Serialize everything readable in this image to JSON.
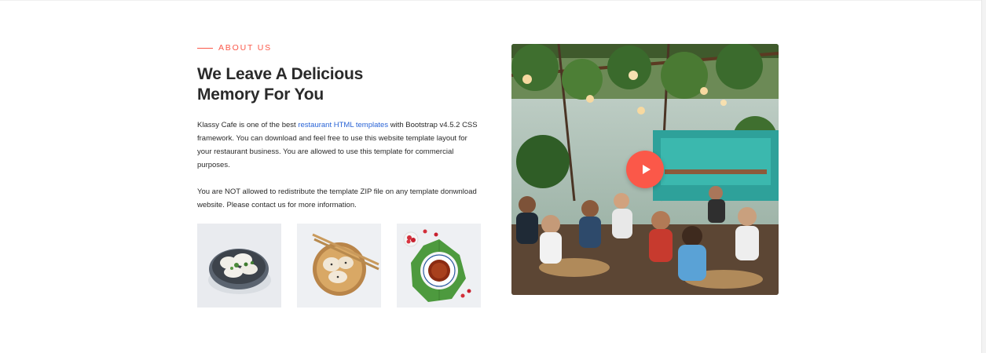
{
  "about": {
    "eyebrow": "About Us",
    "heading": "We Leave A Delicious Memory For You",
    "paragraph1": {
      "before": "Klassy Cafe is one of the best ",
      "link": "restaurant HTML templates",
      "after": " with Bootstrap v4.5.2 CSS framework. You can download and feel free to use this website template layout for your restaurant business. You are allowed to use this template for commercial purposes."
    },
    "paragraph2": "You are NOT allowed to redistribute the template ZIP file on any template donwnload website. Please contact us for more information."
  },
  "thumbnails": [
    {
      "name": "dumplings-bowl-image"
    },
    {
      "name": "dumplings-bamboo-chopsticks-image"
    },
    {
      "name": "tea-cup-raspberries-image"
    }
  ],
  "video": {
    "image": "restaurant-interior-image",
    "play_icon": "play-icon"
  },
  "colors": {
    "accent": "#fb5849",
    "link": "#2a64d6",
    "text": "#2a2a2a"
  }
}
